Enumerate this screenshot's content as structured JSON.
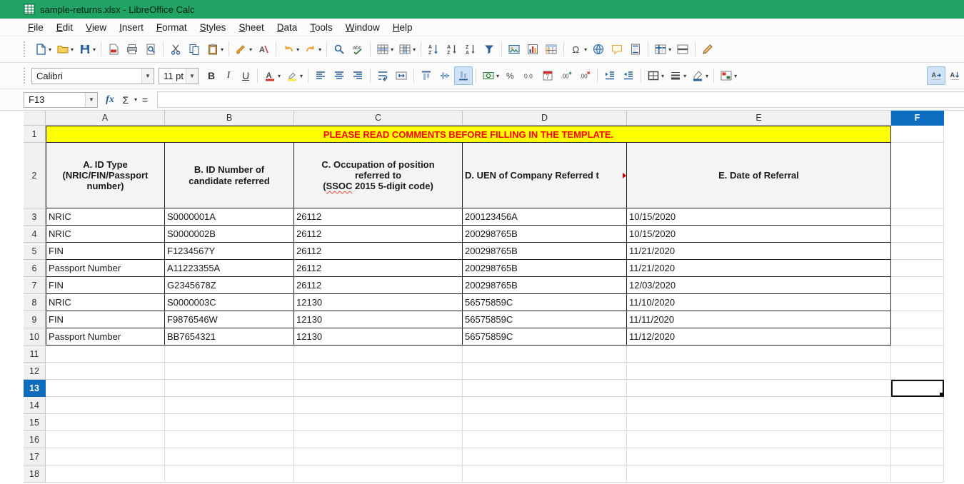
{
  "window": {
    "title": "sample-returns.xlsx - LibreOffice Calc"
  },
  "menubar": {
    "items": [
      "File",
      "Edit",
      "View",
      "Insert",
      "Format",
      "Styles",
      "Sheet",
      "Data",
      "Tools",
      "Window",
      "Help"
    ]
  },
  "standard_toolbar": [
    {
      "name": "new-document",
      "dropdown": true
    },
    {
      "name": "open-file",
      "dropdown": true
    },
    {
      "name": "save",
      "dropdown": true
    },
    {
      "separator": true
    },
    {
      "name": "export-pdf"
    },
    {
      "name": "print"
    },
    {
      "name": "print-preview"
    },
    {
      "separator": true
    },
    {
      "name": "cut"
    },
    {
      "name": "copy"
    },
    {
      "name": "paste",
      "dropdown": true
    },
    {
      "separator": true
    },
    {
      "name": "clone-formatting",
      "dropdown": true
    },
    {
      "name": "clear-formatting"
    },
    {
      "separator": true
    },
    {
      "name": "undo",
      "dropdown": true
    },
    {
      "name": "redo",
      "dropdown": true
    },
    {
      "separator": true
    },
    {
      "name": "find-replace"
    },
    {
      "name": "spelling"
    },
    {
      "separator": true
    },
    {
      "name": "insert-row",
      "dropdown": true
    },
    {
      "name": "insert-column",
      "dropdown": true
    },
    {
      "separator": true
    },
    {
      "name": "sort"
    },
    {
      "name": "sort-ascending"
    },
    {
      "name": "sort-descending"
    },
    {
      "name": "autofilter"
    },
    {
      "separator": true
    },
    {
      "name": "insert-image"
    },
    {
      "name": "insert-chart"
    },
    {
      "name": "insert-pivot-table"
    },
    {
      "separator": true
    },
    {
      "name": "insert-special-character",
      "dropdown": true
    },
    {
      "name": "insert-hyperlink"
    },
    {
      "name": "insert-comment"
    },
    {
      "name": "headers-and-footers"
    },
    {
      "separator": true
    },
    {
      "name": "freeze-rows-and-columns",
      "dropdown": true
    },
    {
      "name": "split-window"
    },
    {
      "separator": true
    },
    {
      "name": "show-draw-functions"
    }
  ],
  "formatting_toolbar": {
    "font_name": "Calibri",
    "font_size": "11 pt",
    "icons": [
      {
        "name": "bold",
        "text": "B"
      },
      {
        "name": "italic",
        "text": "I"
      },
      {
        "name": "underline",
        "text": "U"
      },
      {
        "separator": true
      },
      {
        "name": "font-color",
        "dropdown": true
      },
      {
        "name": "highlighting-color",
        "dropdown": true
      },
      {
        "separator": true
      },
      {
        "name": "align-left"
      },
      {
        "name": "align-center"
      },
      {
        "name": "align-right"
      },
      {
        "separator": true
      },
      {
        "name": "wrap-text"
      },
      {
        "name": "merge-cells"
      },
      {
        "separator": true
      },
      {
        "name": "align-top"
      },
      {
        "name": "center-vertically"
      },
      {
        "name": "align-bottom",
        "active": true
      },
      {
        "separator": true
      },
      {
        "name": "format-as-currency",
        "dropdown": true
      },
      {
        "name": "format-as-percent"
      },
      {
        "name": "format-as-number"
      },
      {
        "name": "format-as-date"
      },
      {
        "name": "add-decimal-place"
      },
      {
        "name": "delete-decimal-place"
      },
      {
        "separator": true
      },
      {
        "name": "increase-indent"
      },
      {
        "name": "decrease-indent"
      },
      {
        "separator": true
      },
      {
        "name": "borders",
        "dropdown": true
      },
      {
        "name": "border-style",
        "dropdown": true
      },
      {
        "name": "border-color",
        "dropdown": true
      },
      {
        "separator": true
      },
      {
        "name": "conditional-formatting",
        "dropdown": true
      },
      {
        "name": "text-direction-ltr",
        "active": true,
        "push": true
      },
      {
        "name": "text-direction-ttb"
      }
    ]
  },
  "formula_bar": {
    "name_box": "F13",
    "fx": "fx",
    "sum": "Σ",
    "equals": "=",
    "formula_value": ""
  },
  "grid": {
    "columns": [
      "A",
      "B",
      "C",
      "D",
      "E",
      "F"
    ],
    "selected_column": "F",
    "rows_start": 1,
    "rows_end": 18,
    "selected_row": 13,
    "selected_cell": "F13",
    "banner": "PLEASE READ COMMENTS BEFORE FILLING IN THE TEMPLATE.",
    "headers": {
      "a": "A. ID Type\n(NRIC/FIN/Passport\nnumber)",
      "b": "B. ID Number of\ncandidate referred",
      "c_line1": "C. Occupation of position",
      "c_line2": "referred to",
      "c_line3_before": "(",
      "c_line3_ssoc": "SSOC",
      "c_line3_after": " 2015 5-digit code)",
      "d": "D. UEN of Company Referred t",
      "e": "E. Date of Referral"
    },
    "first_data_row": 3,
    "data_rows": [
      [
        "NRIC",
        "S0000001A",
        "26112",
        "200123456A",
        "10/15/2020"
      ],
      [
        "NRIC",
        "S0000002B",
        "26112",
        "200298765B",
        "10/15/2020"
      ],
      [
        "FIN",
        "F1234567Y",
        "26112",
        "200298765B",
        "11/21/2020"
      ],
      [
        "Passport Number",
        "A11223355A",
        "26112",
        "200298765B",
        "11/21/2020"
      ],
      [
        "FIN",
        "G2345678Z",
        "26112",
        "200298765B",
        "12/03/2020"
      ],
      [
        "NRIC",
        "S0000003C",
        "12130",
        "56575859C",
        "11/10/2020"
      ],
      [
        "FIN",
        "F9876546W",
        "12130",
        "56575859C",
        "11/11/2020"
      ],
      [
        "Passport Number",
        "BB7654321",
        "12130",
        "56575859C",
        "11/12/2020"
      ]
    ]
  },
  "colors": {
    "titlebar_green": "#21a366",
    "selection_blue": "#0d6cbd",
    "banner_bg": "#ffff00",
    "banner_text": "#ff0000"
  }
}
